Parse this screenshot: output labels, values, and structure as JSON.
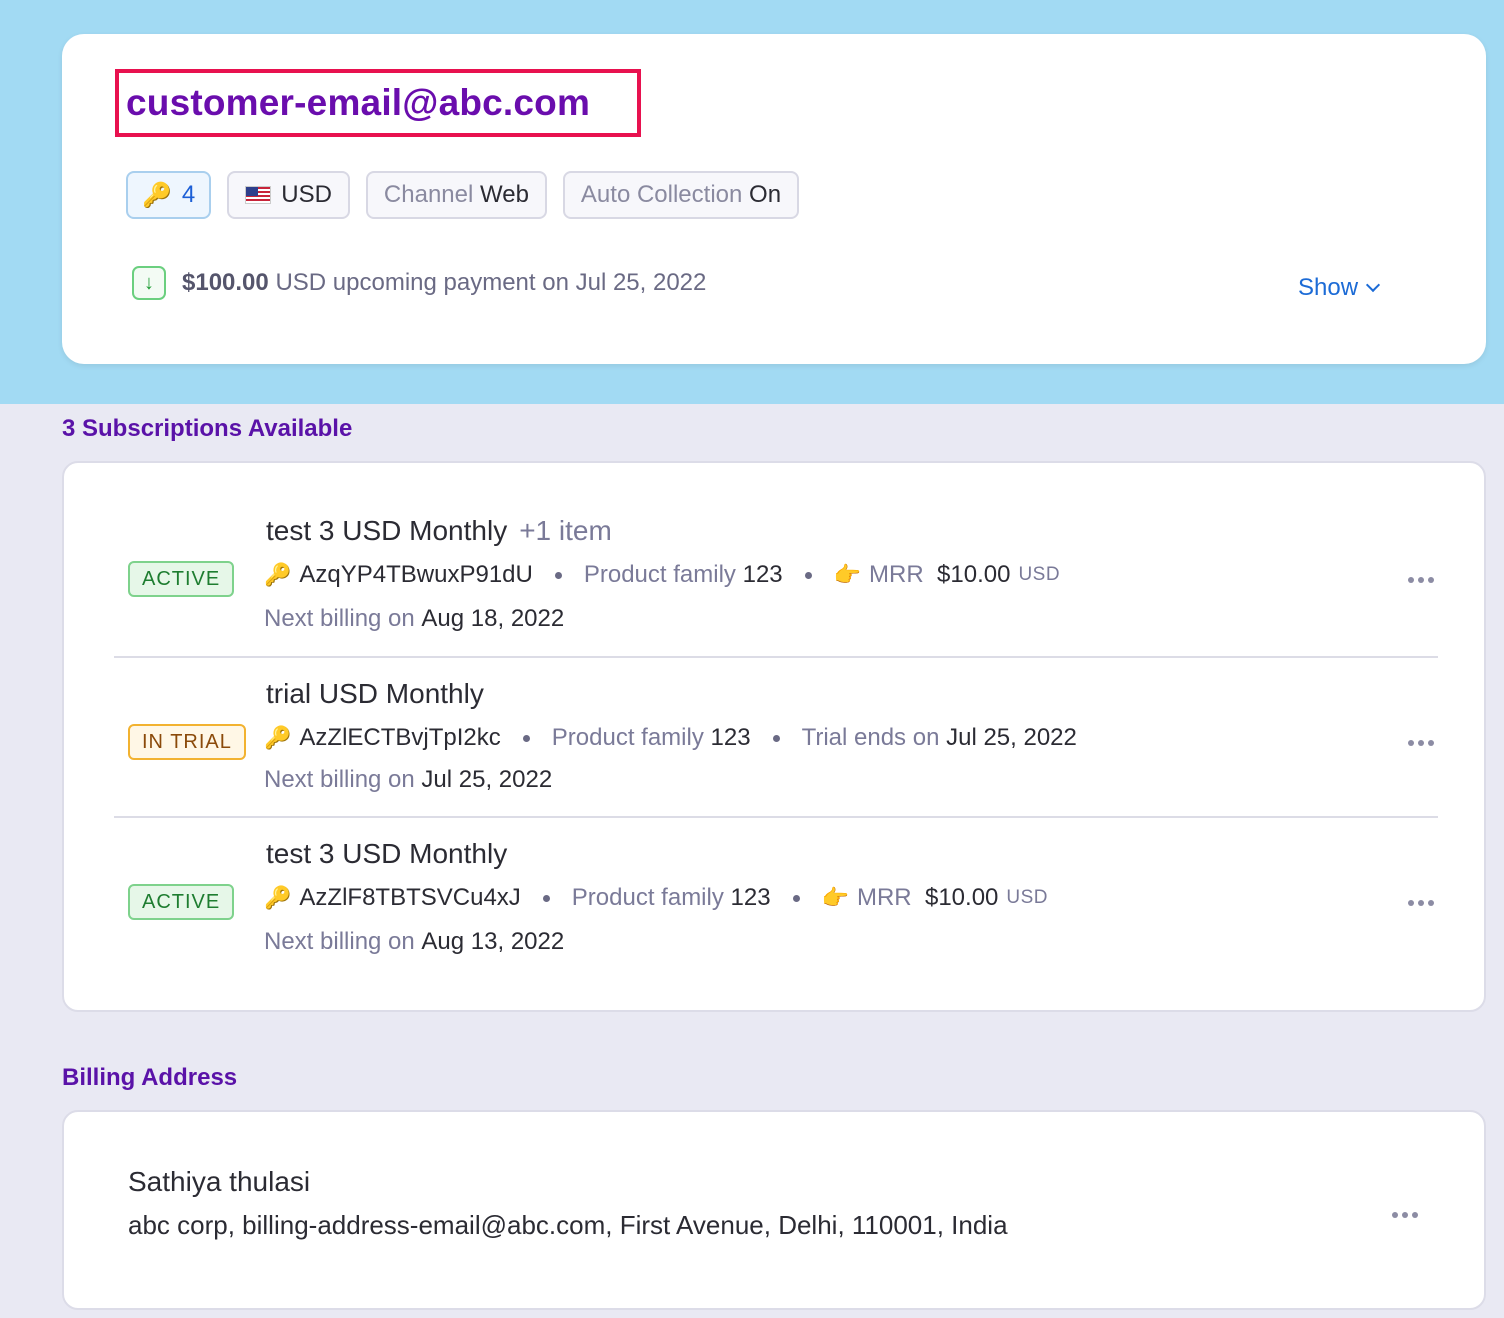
{
  "customer": {
    "email": "customer-email@abc.com",
    "chips": {
      "key_count": "4",
      "currency": "USD",
      "channel_label": "Channel",
      "channel_value": "Web",
      "auto_collection_label": "Auto Collection",
      "auto_collection_value": "On"
    },
    "upcoming_payment": {
      "amount": "$100.00",
      "text": "USD upcoming payment on Jul 25, 2022"
    },
    "show_label": "Show"
  },
  "subscriptions": {
    "heading": "3 Subscriptions Available",
    "items": [
      {
        "status": "ACTIVE",
        "title": "test 3 USD Monthly",
        "extra": "+1 item",
        "id": "AzqYP4TBwuxP91dU",
        "family_label": "Product family",
        "family_value": "123",
        "mrr_label": "MRR",
        "mrr_value": "$10.00",
        "mrr_currency": "USD",
        "next_label": "Next billing on",
        "next_date": "Aug 18, 2022"
      },
      {
        "status": "IN TRIAL",
        "title": "trial USD Monthly",
        "id": "AzZlECTBvjTpI2kc",
        "family_label": "Product family",
        "family_value": "123",
        "trial_label": "Trial ends on",
        "trial_date": "Jul 25, 2022",
        "next_label": "Next billing on",
        "next_date": "Jul 25, 2022"
      },
      {
        "status": "ACTIVE",
        "title": "test 3 USD Monthly",
        "id": "AzZlF8TBTSVCu4xJ",
        "family_label": "Product family",
        "family_value": "123",
        "mrr_label": "MRR",
        "mrr_value": "$10.00",
        "mrr_currency": "USD",
        "next_label": "Next billing on",
        "next_date": "Aug 13, 2022"
      }
    ]
  },
  "billing": {
    "heading": "Billing Address",
    "name": "Sathiya thulasi",
    "address": "abc corp, billing-address-email@abc.com, First Avenue, Delhi, 110001, India"
  },
  "icons": {
    "key": "key-icon",
    "flag": "us-flag-icon",
    "download": "arrow-down-icon",
    "pointing": "pointing-hand-icon",
    "more": "more-horizontal-icon"
  },
  "colors": {
    "accent_purple": "#6a0dad",
    "highlight_red": "#e8114f",
    "link_blue": "#1c6bd6",
    "active_green": "#1e7d30",
    "trial_amber": "#f2b230",
    "top_band": "#a2daf3"
  }
}
